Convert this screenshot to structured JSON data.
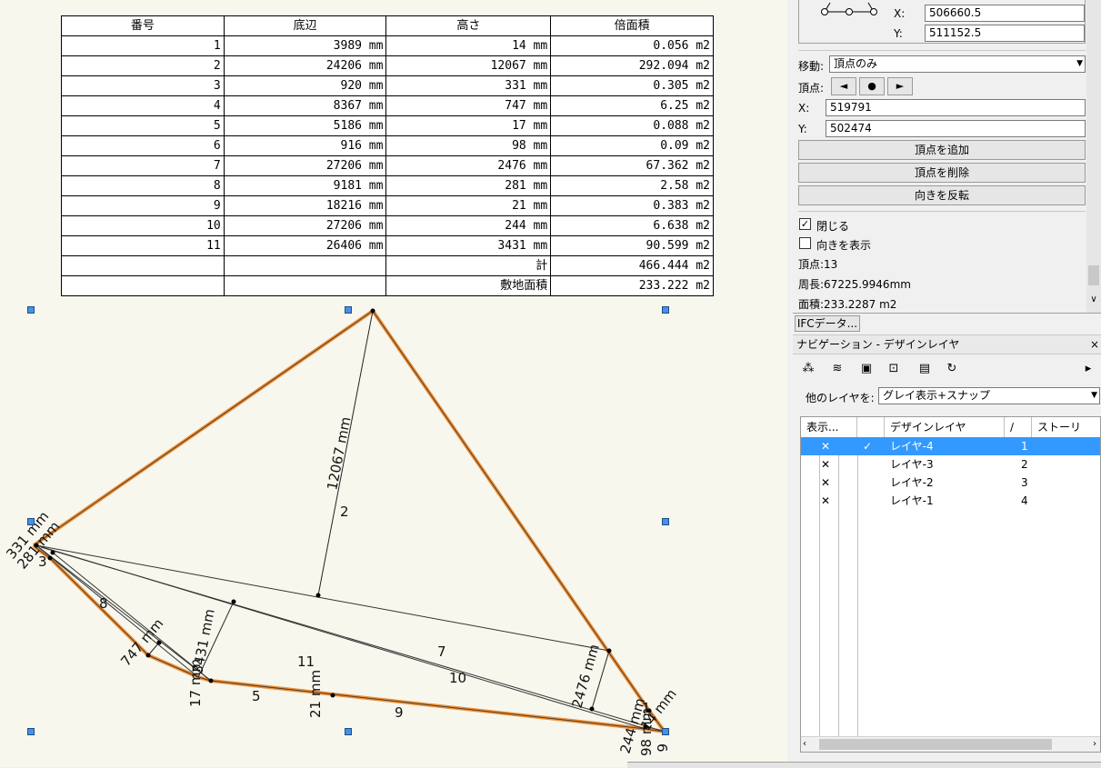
{
  "table": {
    "headers": [
      "番号",
      "底辺",
      "高さ",
      "倍面積"
    ],
    "rows": [
      [
        "1",
        "3989  mm",
        "14  mm",
        "0.056  m2"
      ],
      [
        "2",
        "24206  mm",
        "12067  mm",
        "292.094  m2"
      ],
      [
        "3",
        "920  mm",
        "331  mm",
        "0.305  m2"
      ],
      [
        "4",
        "8367  mm",
        "747  mm",
        "6.25  m2"
      ],
      [
        "5",
        "5186  mm",
        "17  mm",
        "0.088  m2"
      ],
      [
        "6",
        "916  mm",
        "98  mm",
        "0.09  m2"
      ],
      [
        "7",
        "27206  mm",
        "2476  mm",
        "67.362  m2"
      ],
      [
        "8",
        "9181  mm",
        "281  mm",
        "2.58  m2"
      ],
      [
        "9",
        "18216  mm",
        "21  mm",
        "0.383  m2"
      ],
      [
        "10",
        "27206  mm",
        "244  mm",
        "6.638  m2"
      ],
      [
        "11",
        "26406  mm",
        "3431  mm",
        "90.599  m2"
      ]
    ],
    "total_label": "計",
    "total_value": "466.444  m2",
    "site_area_label": "敷地面積",
    "site_area_value": "233.222  m2"
  },
  "drawing": {
    "accent_color": "#e8801e",
    "labels": {
      "height_2": "12067 mm",
      "tri_2": "2",
      "tri_7": "7",
      "tri_10": "10",
      "tri_11": "11",
      "tri_5": "5",
      "tri_9": "9",
      "tri_8": "8",
      "tri_3": "3",
      "h_331": "331 mm",
      "h_281": "281 mm",
      "h_747": "747 mm",
      "h_3431": "3431 mm",
      "h_17": "17 mm",
      "h_21": "21 mm",
      "h_2476": "2476 mm",
      "h_244": "244 mm",
      "h_98": "98 mm",
      "h_14": "14 mm",
      "tri_6": "6",
      "tri_1": "1"
    }
  },
  "object_info": {
    "x_label": "X:",
    "x_value": "506660.5",
    "y_label": "Y:",
    "y_value": "511152.5",
    "move_label": "移動:",
    "move_value": "頂点のみ",
    "vertex_label": "頂点:",
    "vertex_prev": "◄",
    "vertex_mid": "●",
    "vertex_next": "►",
    "vx_label": "X:",
    "vx_value": "519791",
    "vy_label": "Y:",
    "vy_value": "502474",
    "add_vertex": "頂点を追加",
    "delete_vertex": "頂点を削除",
    "reverse_direction": "向きを反転",
    "closed_label": "閉じる",
    "closed_checked": "✓",
    "show_direction_label": "向きを表示",
    "vertex_count": "頂点:13",
    "perimeter": "周長:67225.9946mm",
    "area": "面積:233.2287 m2"
  },
  "ifc_button": "IFCデータ...",
  "navigation": {
    "title": "ナビゲーション - デザインレイヤ",
    "close": "×",
    "other_layers_label": "他のレイヤを:",
    "other_layers_value": "グレイ表示+スナップ",
    "columns": [
      "表示...",
      "デザインレイヤ",
      "ストーリ"
    ],
    "layers": [
      {
        "name": "レイヤ-4",
        "order": "1",
        "active": "✓"
      },
      {
        "name": "レイヤ-3",
        "order": "2",
        "active": ""
      },
      {
        "name": "レイヤ-2",
        "order": "3",
        "active": ""
      },
      {
        "name": "レイヤ-1",
        "order": "4",
        "active": ""
      }
    ]
  }
}
